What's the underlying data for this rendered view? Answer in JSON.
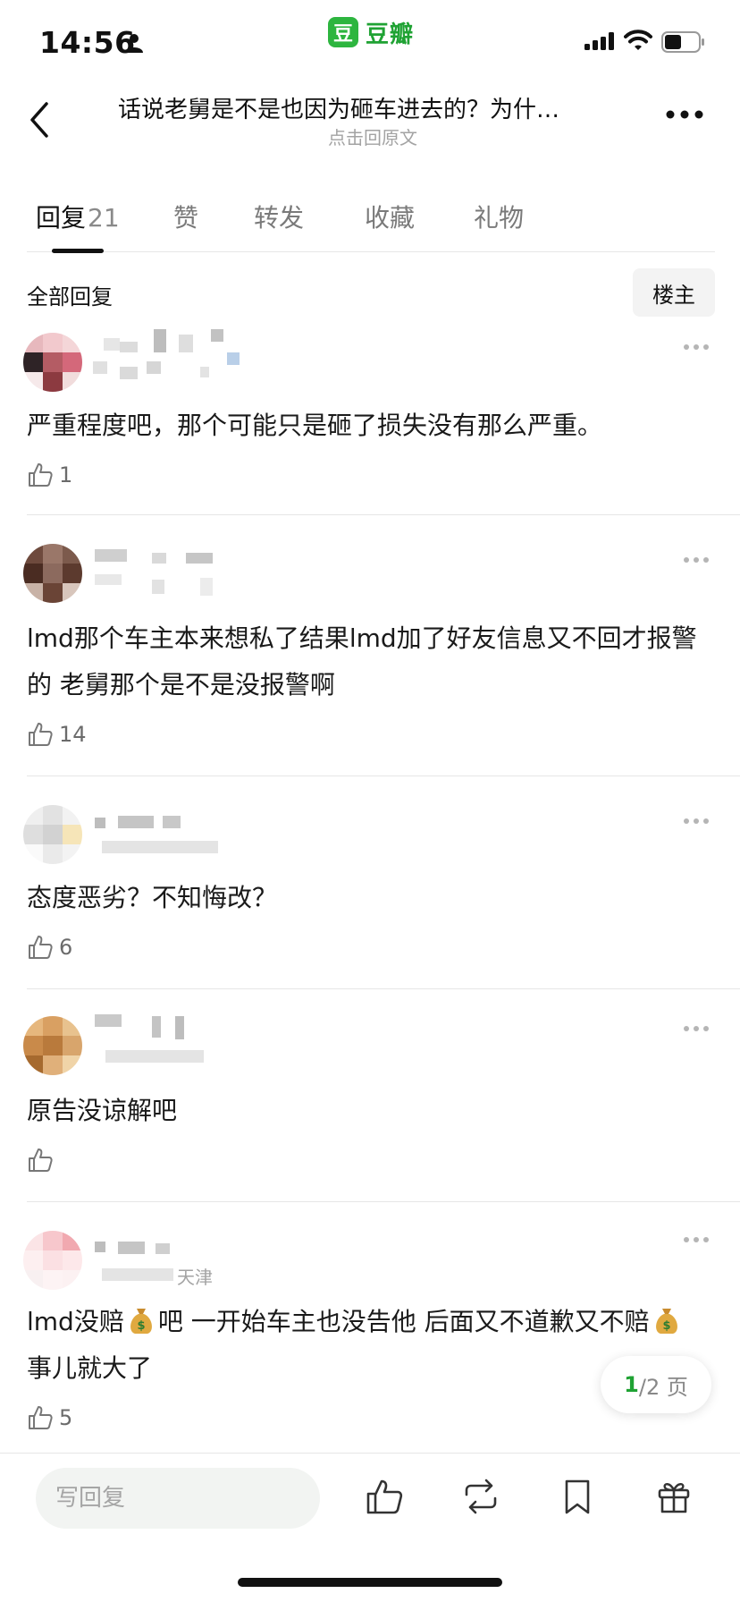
{
  "status_bar": {
    "time": "14:56",
    "app_logo_char": "豆",
    "app_name": "豆瓣"
  },
  "header": {
    "title": "话说老舅是不是也因为砸车进去的？为什…",
    "subtitle": "点击回原文"
  },
  "tabs": [
    {
      "label": "回复",
      "count": "21"
    },
    {
      "label": "赞"
    },
    {
      "label": "转发"
    },
    {
      "label": "收藏"
    },
    {
      "label": "礼物"
    }
  ],
  "section": {
    "title": "全部回复",
    "filter_label": "楼主"
  },
  "comments": [
    {
      "text": "严重程度吧，那个可能只是砸了损失没有那么严重。",
      "likes": "1"
    },
    {
      "text": "lmd那个车主本来想私了结果lmd加了好友信息又不回才报警的  老舅那个是不是没报警啊",
      "likes": "14"
    },
    {
      "text": "态度恶劣？不知悔改？",
      "likes": "6"
    },
    {
      "text": "原告没谅解吧",
      "likes": ""
    },
    {
      "location_visible": "天津",
      "text_part1": "lmd没赔",
      "text_part2": "吧 一开始车主也没告他 后面又不道歉又不赔",
      "text_part3": "事儿就大了",
      "likes": "5"
    }
  ],
  "pagination": {
    "current": "1",
    "total": "/2 页"
  },
  "bottom_bar": {
    "reply_placeholder": "写回复"
  },
  "colors": {
    "brand_green": "#2db53f",
    "accent_green": "#1fa233"
  },
  "icons": [
    "person-icon",
    "signal-icon",
    "wifi-icon",
    "battery-icon",
    "back-icon",
    "more-icon",
    "thumbs-up-icon",
    "money-bag-icon",
    "repost-icon",
    "bookmark-icon",
    "gift-icon"
  ]
}
